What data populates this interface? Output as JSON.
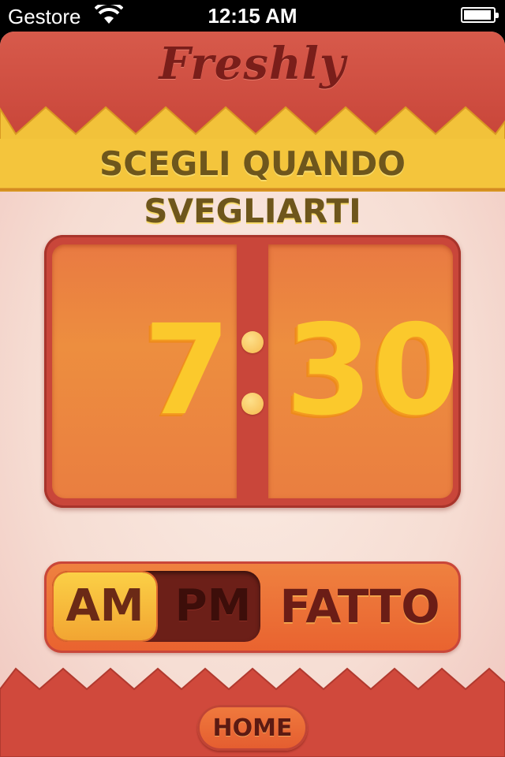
{
  "status_bar": {
    "carrier": "Gestore",
    "time": "12:15 AM"
  },
  "app": {
    "logo": "Freshly",
    "banner_title": "SCEGLI QUANDO SVEGLIARTI"
  },
  "time_picker": {
    "hour": "7",
    "minute": "30"
  },
  "period_toggle": {
    "am_label": "AM",
    "pm_label": "PM",
    "selected": "AM"
  },
  "actions": {
    "done_label": "FATTO",
    "home_label": "HOME"
  },
  "colors": {
    "header_red": "#c9463a",
    "banner_yellow": "#f2c23a",
    "digit_yellow": "#fbc92c",
    "panel_orange": "#ed8e3f"
  }
}
